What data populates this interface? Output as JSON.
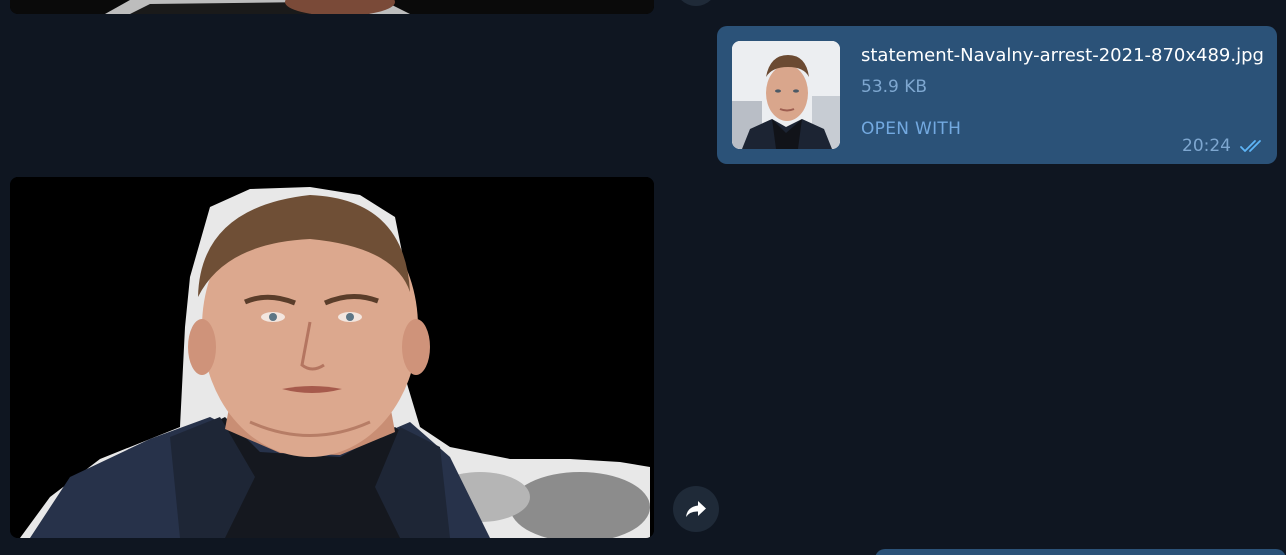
{
  "file_message": {
    "file_name": "statement-Navalny-arrest-2021-870x489.jpg",
    "file_size": "53.9 KB",
    "open_with_label": "OPEN WITH",
    "time": "20:24",
    "status_icon": "double-check-read-icon"
  },
  "photo_message": {
    "image_subject": "portrait-photo",
    "forward_icon": "forward-arrow-icon"
  },
  "colors": {
    "background": "#0f1621",
    "outgoing_bubble": "#2b5278",
    "accent": "#73a9e0",
    "round_button": "#1f2a38"
  }
}
